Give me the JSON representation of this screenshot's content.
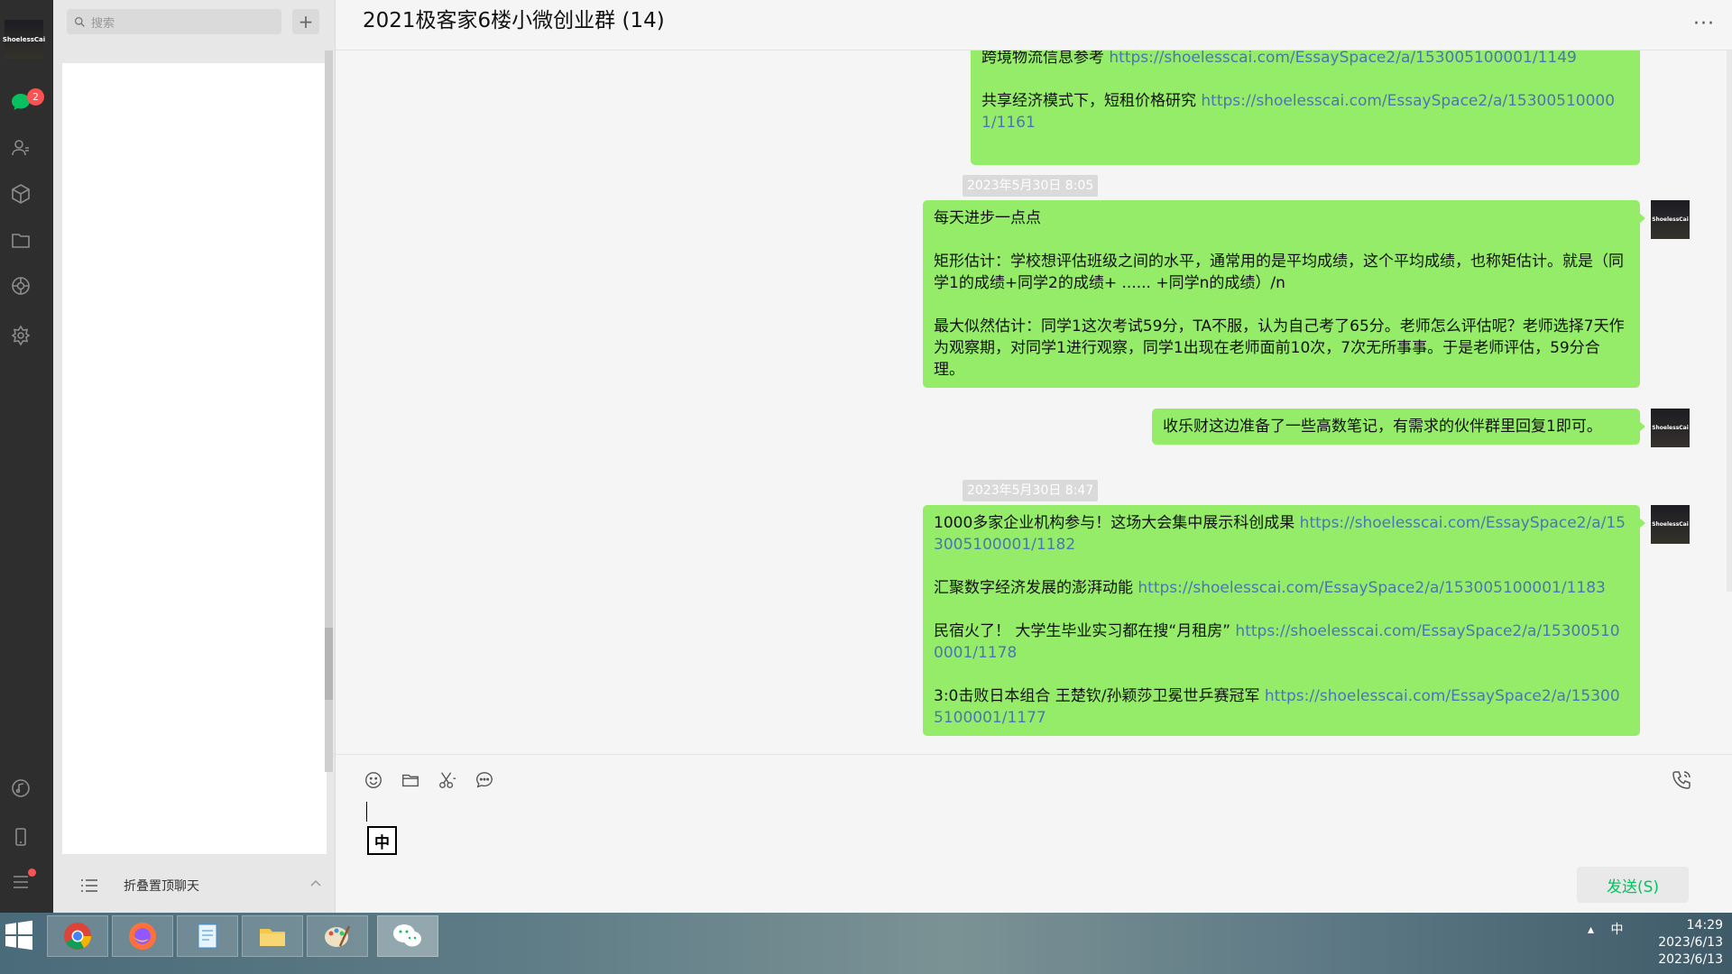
{
  "rail": {
    "avatar_text": "ShoelessCai",
    "badge_count": "2",
    "icons": [
      "chat-icon",
      "contacts-icon",
      "favorites-icon",
      "files-icon",
      "moments-icon",
      "miniprogram-icon",
      "music-icon",
      "phone-icon",
      "menu-icon"
    ]
  },
  "sidebar": {
    "search_placeholder": "搜索",
    "add_label": "+",
    "fold_label": "折叠置顶聊天"
  },
  "chat": {
    "title": "2021极客家6楼小微创业群 (14)",
    "more_label": "···",
    "messages": [
      {
        "paragraphs": [
          {
            "text": "跨境物流信息参考 ",
            "link": "https://shoelesscai.com/EssaySpace2/a/153005100001/1149"
          },
          {
            "text": "共享经济模式下，短租价格研究 ",
            "link": "https://shoelesscai.com/EssaySpace2/a/153005100001/1161"
          }
        ]
      },
      {
        "timestamp": "2023年5月30日 8:05",
        "paragraphs": [
          {
            "text": "每天进步一点点",
            "link": ""
          },
          {
            "text": "矩形估计：学校想评估班级之间的水平，通常用的是平均成绩，这个平均成绩，也称矩估计。就是（同学1的成绩+同学2的成绩+ ...... +同学n的成绩）/n",
            "link": ""
          },
          {
            "text": "最大似然估计：同学1这次考试59分，TA不服，认为自己考了65分。老师怎么评估呢？老师选择7天作为观察期，对同学1进行观察，同学1出现在老师面前10次，7次无所事事。于是老师评估，59分合理。",
            "link": ""
          }
        ]
      },
      {
        "paragraphs": [
          {
            "text": "收乐财这边准备了一些高数笔记，有需求的伙伴群里回复1即可。",
            "link": ""
          }
        ]
      },
      {
        "timestamp": "2023年5月30日 8:47",
        "paragraphs": [
          {
            "text": "1000多家企业机构参与！这场大会集中展示科创成果 ",
            "link": "https://shoelesscai.com/EssaySpace2/a/153005100001/1182"
          },
          {
            "text": "汇聚数字经济发展的澎湃动能 ",
            "link": "https://shoelesscai.com/EssaySpace2/a/153005100001/1183"
          },
          {
            "text": "民宿火了！ 大学生毕业实习都在搜“月租房” ",
            "link": "https://shoelesscai.com/EssaySpace2/a/153005100001/1178"
          },
          {
            "text": "3:0击败日本组合 王楚钦/孙颖莎卫冕世乒赛冠军 ",
            "link": "https://shoelesscai.com/EssaySpace2/a/153005100001/1177"
          }
        ]
      }
    ]
  },
  "input": {
    "ime_indicator": "中",
    "send_label": "发送(S)",
    "toolbar_icons": [
      "emoji-icon",
      "folder-icon",
      "scissors-icon",
      "chat-history-icon"
    ]
  },
  "taskbar": {
    "apps": [
      "chrome-icon",
      "firefox-icon",
      "notepad-icon",
      "file-explorer-icon",
      "paint-icon",
      "wechat-icon"
    ],
    "ime": "中",
    "time": "14:29",
    "date": "2023/6/13",
    "date_repeat": "2023/6/13"
  },
  "colors": {
    "bubble": "#95ec69",
    "link": "#4a76b5",
    "send_text": "#07c160",
    "badge": "#fa5151",
    "rail": "#2e2e2e"
  }
}
